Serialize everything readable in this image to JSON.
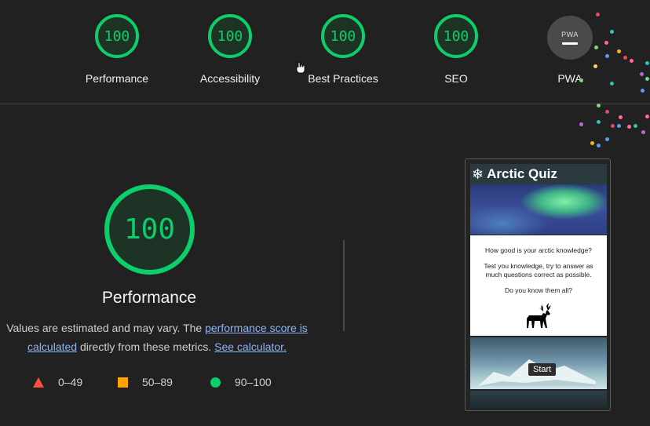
{
  "gauges": [
    {
      "score": "100",
      "label": "Performance"
    },
    {
      "score": "100",
      "label": "Accessibility"
    },
    {
      "score": "100",
      "label": "Best Practices"
    },
    {
      "score": "100",
      "label": "SEO"
    }
  ],
  "pwa": {
    "badge_text": "PWA",
    "label": "PWA"
  },
  "main": {
    "score": "100",
    "title": "Performance",
    "desc_prefix": "Values are estimated and may vary. The ",
    "score_link": "performance score is calculated",
    "desc_middle": " directly from these metrics. ",
    "calc_link": "See calculator."
  },
  "legend": [
    {
      "range": "0–49",
      "color": "#ff4e42"
    },
    {
      "range": "50–89",
      "color": "#ffa400"
    },
    {
      "range": "90–100",
      "color": "#0cce6b"
    }
  ],
  "screenshot": {
    "header": "Arctic Quiz",
    "question": "How good is your arctic knowledge?",
    "instruction": "Test you knowledge, try to answer as much questions correct as possible.",
    "prompt": "Do you know them all?",
    "start_label": "Start"
  },
  "colors": {
    "pass": "#0cce6b",
    "background": "#212121"
  }
}
